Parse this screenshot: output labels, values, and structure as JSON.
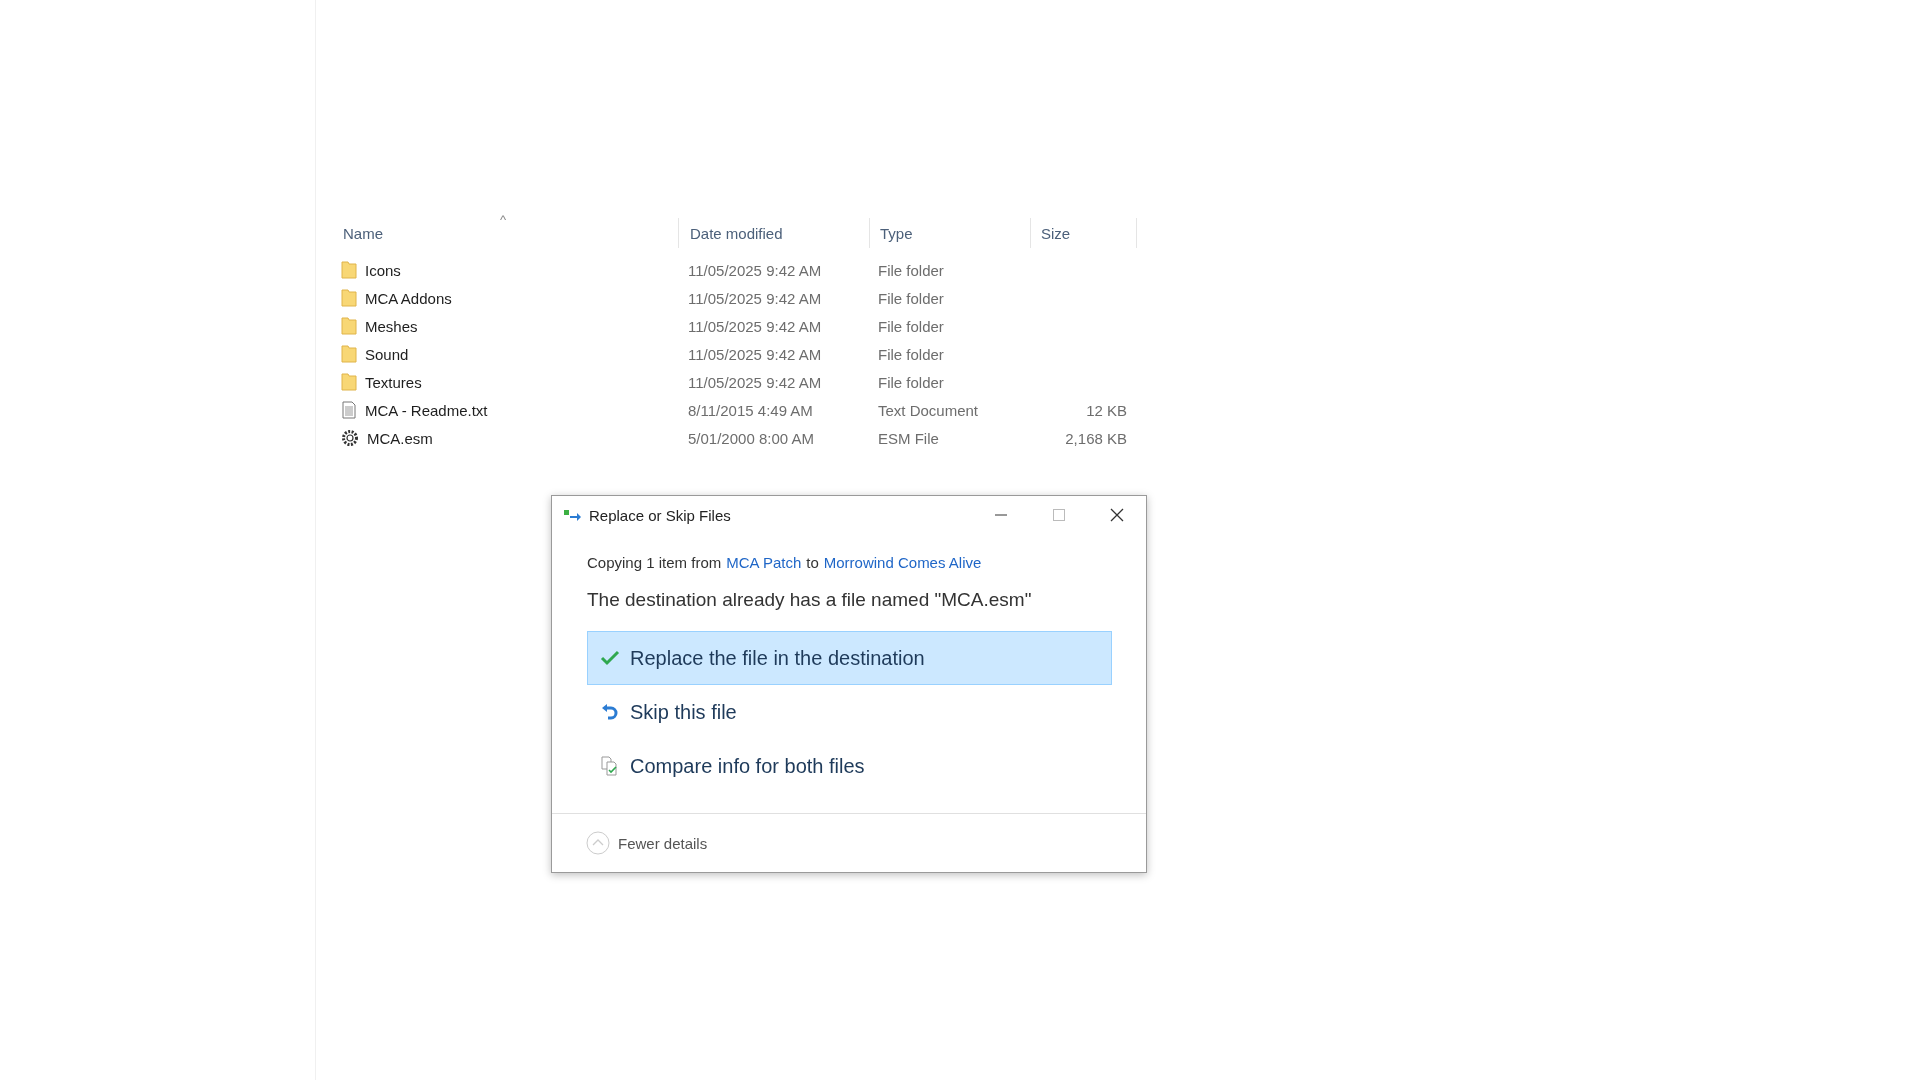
{
  "file_list": {
    "sort_indicator": "^",
    "columns": [
      "Name",
      "Date modified",
      "Type",
      "Size"
    ],
    "rows": [
      {
        "kind": "folder",
        "name": "Icons",
        "date": "11/05/2025 9:42 AM",
        "type": "File folder"
      },
      {
        "kind": "folder",
        "name": "MCA Addons",
        "date": "11/05/2025 9:42 AM",
        "type": "File folder"
      },
      {
        "kind": "folder",
        "name": "Meshes",
        "date": "11/05/2025 9:42 AM",
        "type": "File folder"
      },
      {
        "kind": "folder",
        "name": "Sound",
        "date": "11/05/2025 9:42 AM",
        "type": "File folder"
      },
      {
        "kind": "folder",
        "name": "Textures",
        "date": "11/05/2025 9:42 AM",
        "type": "File folder"
      },
      {
        "kind": "text",
        "name": "MCA - Readme.txt",
        "date": "8/11/2015 4:49 AM",
        "type": "Text Document",
        "size": "12 KB"
      },
      {
        "kind": "esm",
        "name": "MCA.esm",
        "date": "5/01/2000 8:00 AM",
        "type": "ESM File",
        "size": "2,168 KB"
      }
    ]
  },
  "dialog": {
    "title": "Replace or Skip Files",
    "copy_prefix": "Copying 1 item from",
    "source": "MCA Patch",
    "joiner": "to",
    "destination": "Morrowind Comes Alive",
    "message": "The destination already has a file named \"MCA.esm\"",
    "options": [
      {
        "kind": "replace",
        "label": "Replace the file in the destination",
        "selected": true
      },
      {
        "kind": "skip",
        "label": "Skip this file",
        "selected": false
      },
      {
        "kind": "compare",
        "label": "Compare info for both files",
        "selected": false
      }
    ],
    "details_toggle": "Fewer details"
  }
}
